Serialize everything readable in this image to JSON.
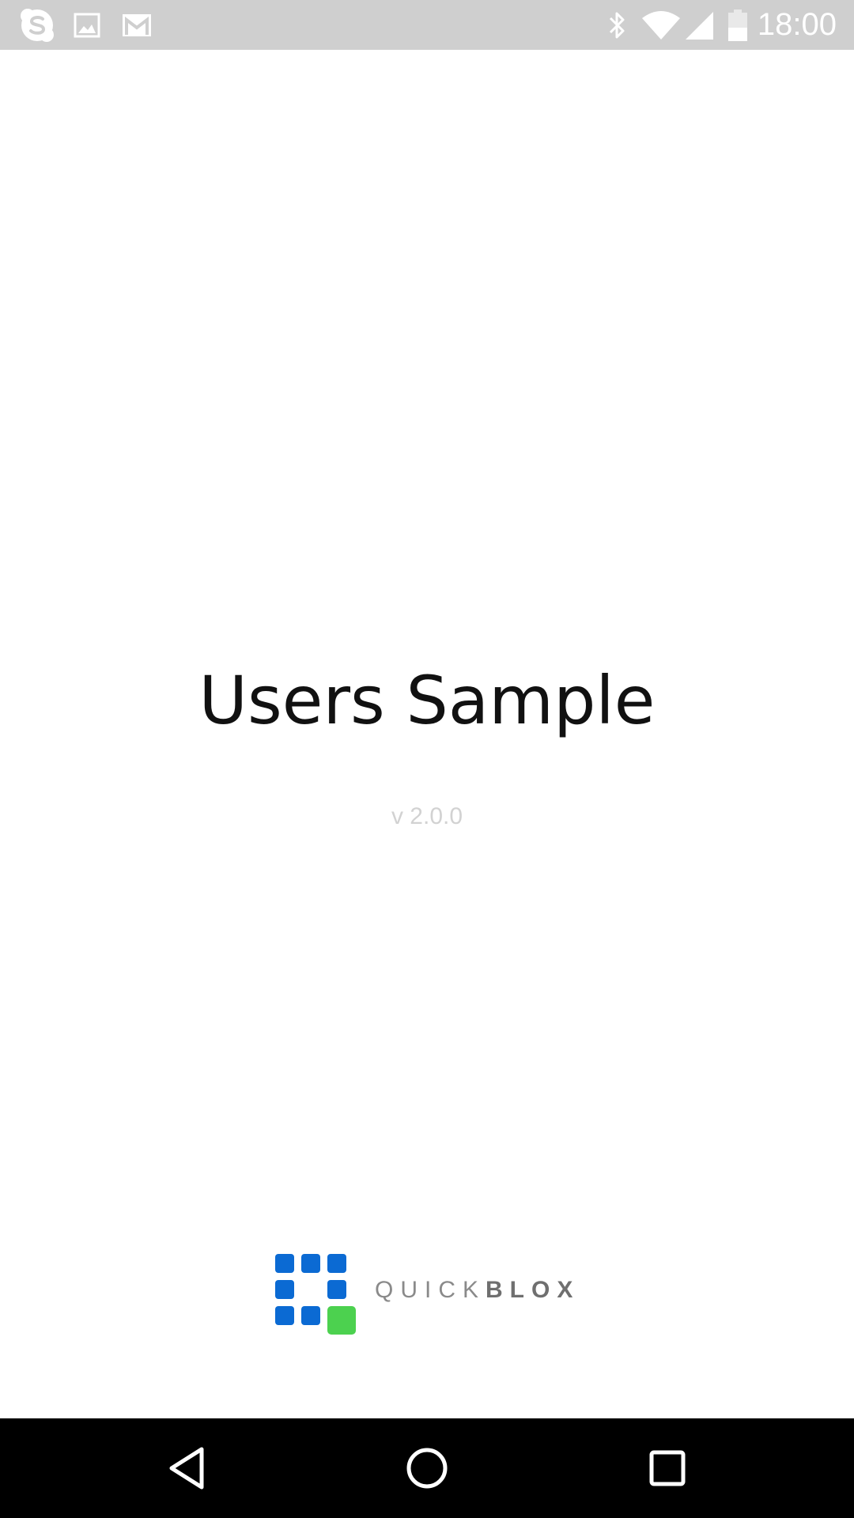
{
  "status_bar": {
    "time": "18:00",
    "left_icons": [
      "skype-icon",
      "image-icon",
      "gmail-icon"
    ],
    "right_icons": [
      "bluetooth-icon",
      "wifi-icon",
      "cell-signal-icon",
      "battery-icon"
    ],
    "background": "#cfcfcf"
  },
  "splash": {
    "title": "Users Sample",
    "version": "v 2.0.0"
  },
  "brand": {
    "wordmark_light": "QUICK",
    "wordmark_bold": "BLOX",
    "colors": {
      "blue": "#0b6ad3",
      "green": "#4cd14f"
    }
  },
  "nav_bar": {
    "buttons": [
      "back-icon",
      "home-icon",
      "recents-icon"
    ]
  }
}
